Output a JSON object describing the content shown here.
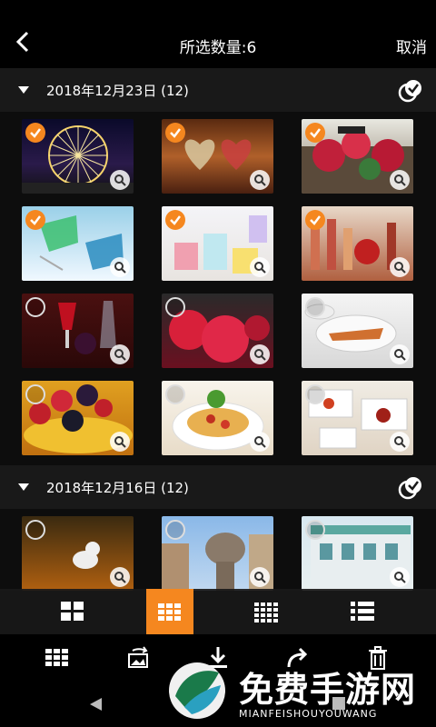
{
  "header": {
    "title": "所选数量:6",
    "cancel_label": "取消"
  },
  "sections": [
    {
      "date_label": "2018年12月23日 (12)"
    },
    {
      "date_label": "2018年12月16日 (12)"
    }
  ],
  "photos_section1": [
    {
      "subject": "ferris-wheel",
      "selected": true
    },
    {
      "subject": "heart-ornaments",
      "selected": true
    },
    {
      "subject": "flower-street",
      "selected": true
    },
    {
      "subject": "perfume-glasses",
      "selected": true
    },
    {
      "subject": "candles",
      "selected": true
    },
    {
      "subject": "glass-bottles",
      "selected": false
    },
    {
      "subject": "wine-dessert",
      "selected": false
    },
    {
      "subject": "raspberry-dessert",
      "selected": false
    },
    {
      "subject": "plated-dishes",
      "selected": false
    },
    {
      "subject": "berry-tart",
      "selected": false
    },
    {
      "subject": "pasta",
      "selected": false
    },
    {
      "subject": "appetizer-plates",
      "selected": false
    }
  ],
  "photos_section2": [
    {
      "subject": "dog-in-field",
      "selected": false
    },
    {
      "subject": "stone-tower",
      "selected": false
    },
    {
      "subject": "building",
      "selected": false
    }
  ],
  "view_modes": [
    "grid-2",
    "grid-3",
    "grid-4",
    "list"
  ],
  "active_view_mode": "grid-3",
  "actions": [
    "grid",
    "slideshow",
    "download",
    "share",
    "delete"
  ],
  "watermark": {
    "cn": "免费手游网",
    "en": "MIANFEISHOUYOUWANG"
  },
  "colors": {
    "accent": "#f5871f",
    "background": "#000000",
    "section_header": "#191919"
  }
}
